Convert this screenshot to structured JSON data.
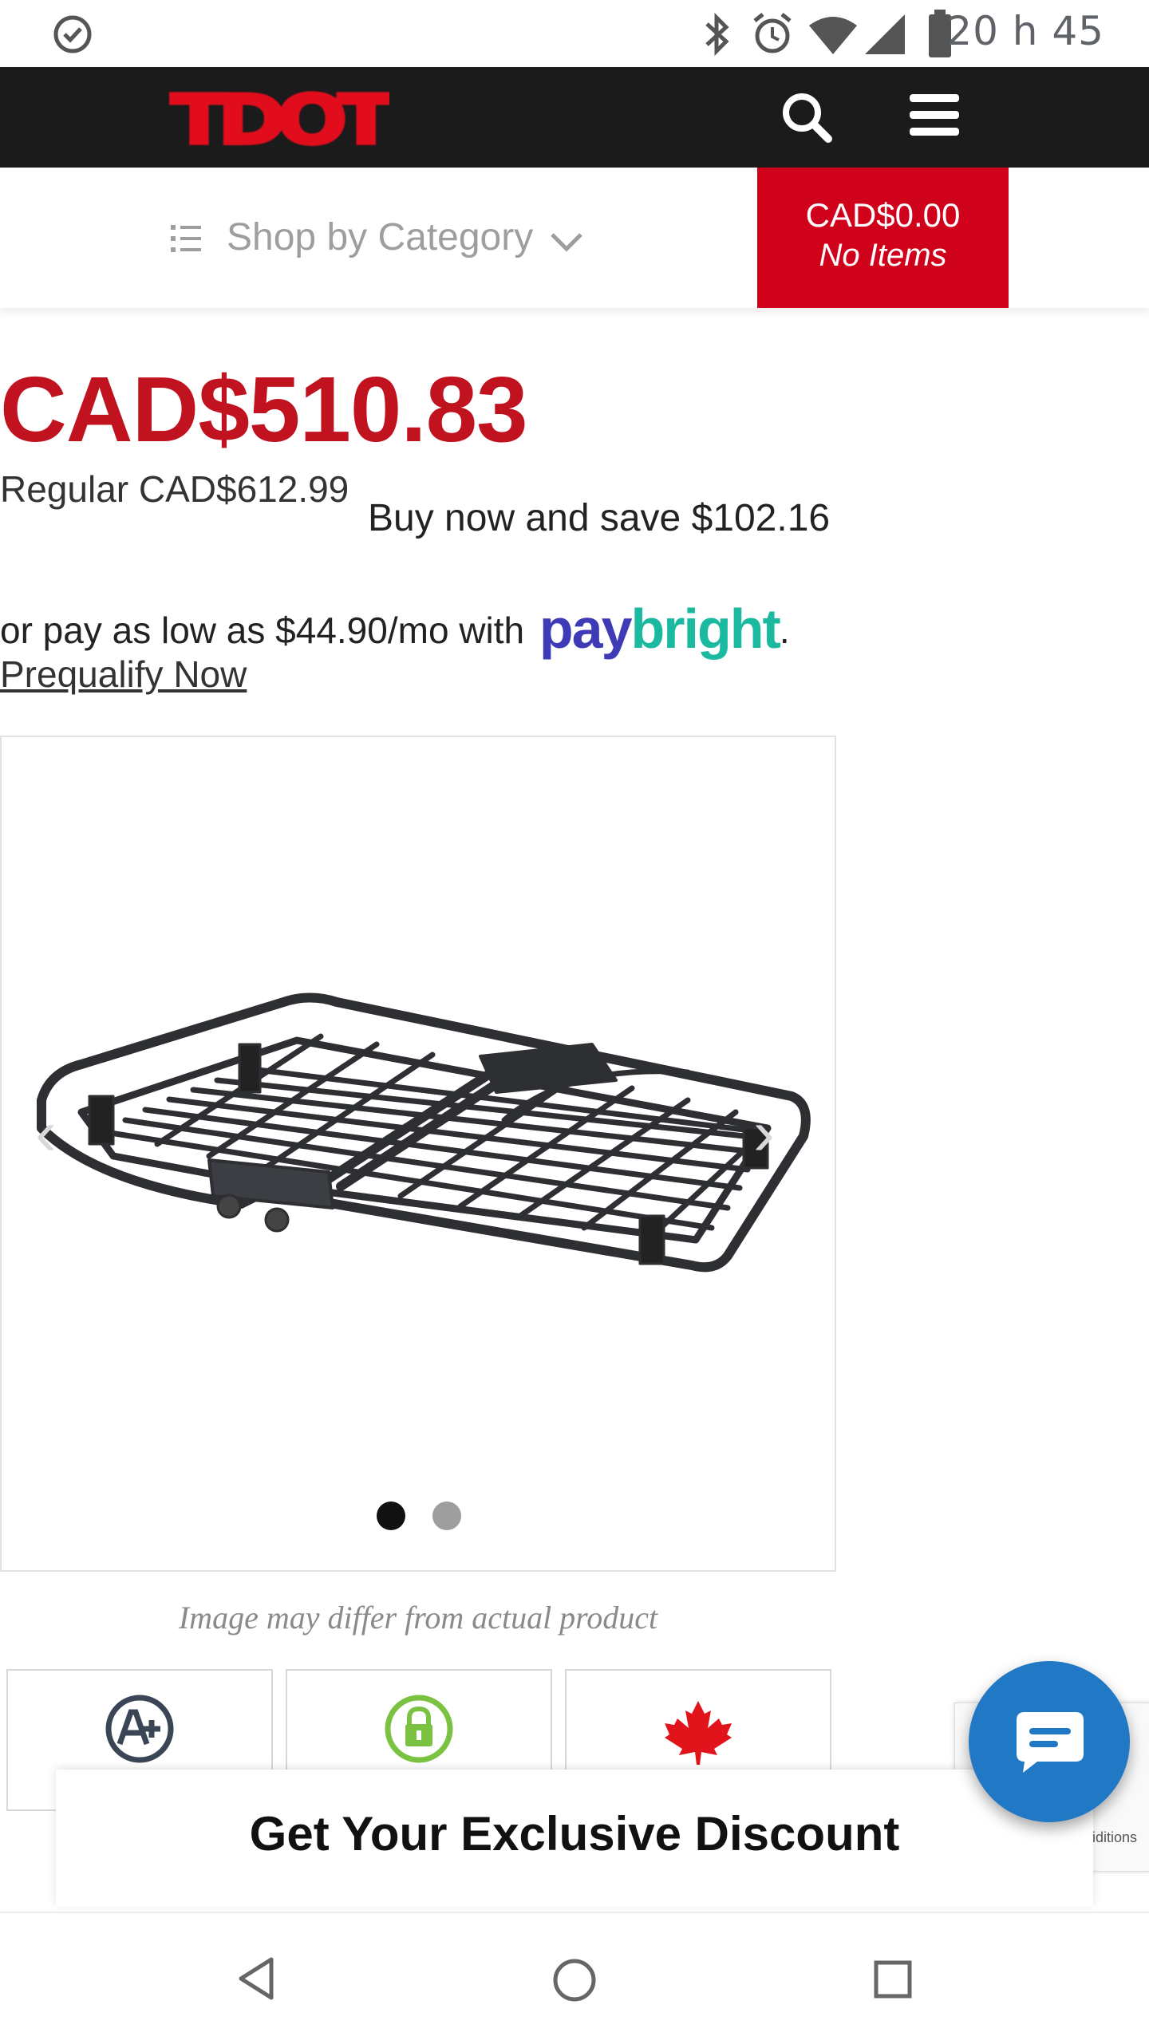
{
  "status_bar": {
    "time": "20 h 45",
    "icons": [
      "sync-clock-icon",
      "bluetooth-icon",
      "alarm-icon",
      "wifi-icon",
      "cell-signal-icon",
      "battery-icon"
    ]
  },
  "header": {
    "logo_text": "TDOT",
    "search_icon": "search-icon",
    "menu_icon": "hamburger-menu-icon"
  },
  "category_bar": {
    "label": "Shop by Category",
    "cart_amount": "CAD$0.00",
    "cart_items": "No Items"
  },
  "pricing": {
    "sale_price": "CAD$510.83",
    "regular_price": "Regular CAD$612.99",
    "savings": "Buy now and save $102.16",
    "paybright_text": "or pay as low as $44.90/mo with",
    "paybright_logo_pay": "pay",
    "paybright_logo_bright": "bright",
    "paybright_period": ".",
    "prequalify_link": "Prequalify Now"
  },
  "gallery": {
    "slide_count": 2,
    "active_slide": 1,
    "note": "Image may differ from actual product"
  },
  "badges": [
    {
      "icon": "a-plus-rating-icon"
    },
    {
      "icon": "secure-lock-icon"
    },
    {
      "icon": "canada-maple-leaf-icon"
    }
  ],
  "recaptcha": {
    "text": "iditions"
  },
  "discount_banner": {
    "text": "Get Your Exclusive Discount"
  },
  "colors": {
    "brand_red": "#d0021b",
    "price_red": "#c1121f",
    "header_black": "#1b1b1b",
    "chat_blue": "#2179c5",
    "paybright_purple": "#3f3bb7",
    "paybright_teal": "#1ab9a0"
  }
}
